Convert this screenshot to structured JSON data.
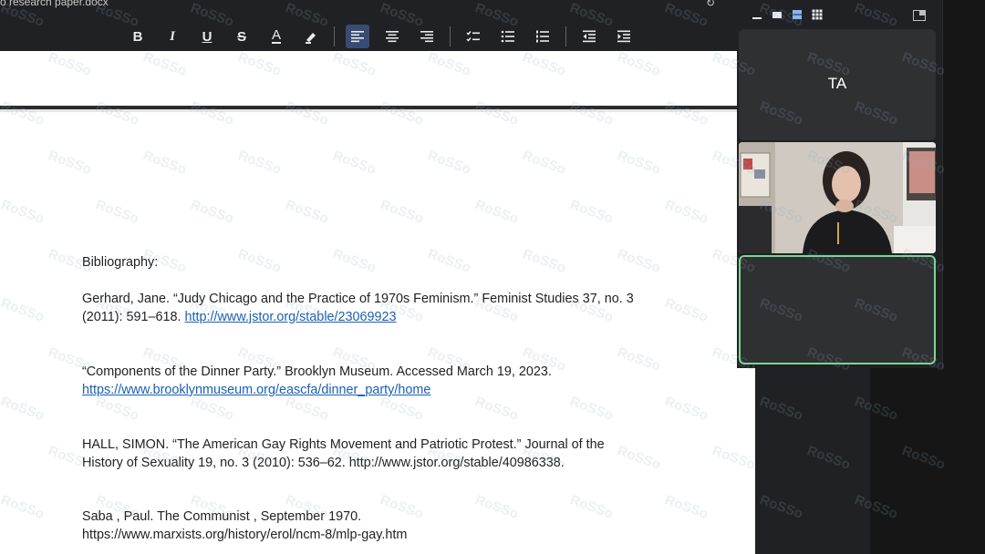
{
  "document": {
    "title": "o research paper.docx",
    "heading": "Bibliography:",
    "entries": [
      {
        "line1": "Gerhard, Jane. “Judy Chicago and the Practice of 1970s Feminism.” Feminist Studies 37, no. 3",
        "line2_prefix": "(2011): 591–618. ",
        "link": "http://www.jstor.org/stable/23069923"
      },
      {
        "line1": "“Components of the Dinner Party.” Brooklyn Museum. Accessed March 19, 2023.",
        "link": "https://www.brooklynmuseum.org/eascfa/dinner_party/home"
      },
      {
        "line1": "HALL, SIMON. “The American Gay Rights Movement and Patriotic Protest.” Journal of the",
        "line2": "History of Sexuality 19, no. 3 (2010): 536–62. http://www.jstor.org/stable/40986338."
      },
      {
        "line1": "Saba , Paul. The Communist , September 1970.",
        "line2": "https://www.marxists.org/history/erol/ncm-8/mlp-gay.htm"
      }
    ]
  },
  "toolbar": {
    "buttons": [
      {
        "name": "bold-button",
        "label": "B",
        "icon": "bold-icon"
      },
      {
        "name": "italic-button",
        "label": "I",
        "icon": "italic-icon"
      },
      {
        "name": "underline-button",
        "label": "U",
        "icon": "underline-icon"
      },
      {
        "name": "strikethrough-button",
        "label": "S",
        "icon": "strikethrough-icon"
      },
      {
        "name": "text-color-button",
        "label": "A",
        "icon": "text-color-icon"
      },
      {
        "name": "highlight-button",
        "icon": "highlighter-icon"
      },
      {
        "name": "align-left-button",
        "icon": "align-left-icon",
        "active": true
      },
      {
        "name": "align-center-button",
        "icon": "align-center-icon"
      },
      {
        "name": "align-right-button",
        "icon": "align-right-icon"
      },
      {
        "name": "checklist-button",
        "icon": "checklist-icon"
      },
      {
        "name": "bullet-list-button",
        "icon": "bullet-list-icon"
      },
      {
        "name": "numbered-list-button",
        "icon": "numbered-list-icon"
      },
      {
        "name": "decrease-indent-button",
        "icon": "decrease-indent-icon"
      },
      {
        "name": "increase-indent-button",
        "icon": "increase-indent-icon"
      }
    ]
  },
  "meeting": {
    "participant_initials": "TA",
    "active_border_color": "#7bd88f",
    "accent_color": "#8ab4f8"
  },
  "watermark": {
    "text": "RoSSo"
  }
}
